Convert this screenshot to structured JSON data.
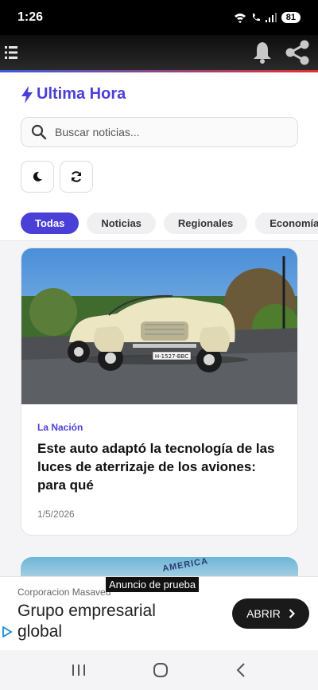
{
  "status_bar": {
    "time": "1:26",
    "battery": "81"
  },
  "app": {
    "brand": "Ultima Hora"
  },
  "search": {
    "placeholder": "Buscar noticias..."
  },
  "tabs": [
    {
      "label": "Todas",
      "active": true
    },
    {
      "label": "Noticias",
      "active": false
    },
    {
      "label": "Regionales",
      "active": false
    },
    {
      "label": "Economía",
      "active": false
    }
  ],
  "articles": [
    {
      "source": "La Nación",
      "title": "Este auto adaptó la tecnología de las luces de aterrizaje de los aviones: para qué",
      "date": "1/5/2026",
      "image_plate": "H-1527-BBC"
    },
    {
      "image_text": "AMERICA"
    }
  ],
  "ad": {
    "label": "Anuncio de prueba",
    "advertiser": "Corporacion Masaveu",
    "headline": "Grupo empresarial global",
    "cta": "ABRIR"
  },
  "colors": {
    "accent": "#4a3fd6",
    "stripe_left": "#3b5bdb",
    "stripe_right": "#e03131"
  }
}
